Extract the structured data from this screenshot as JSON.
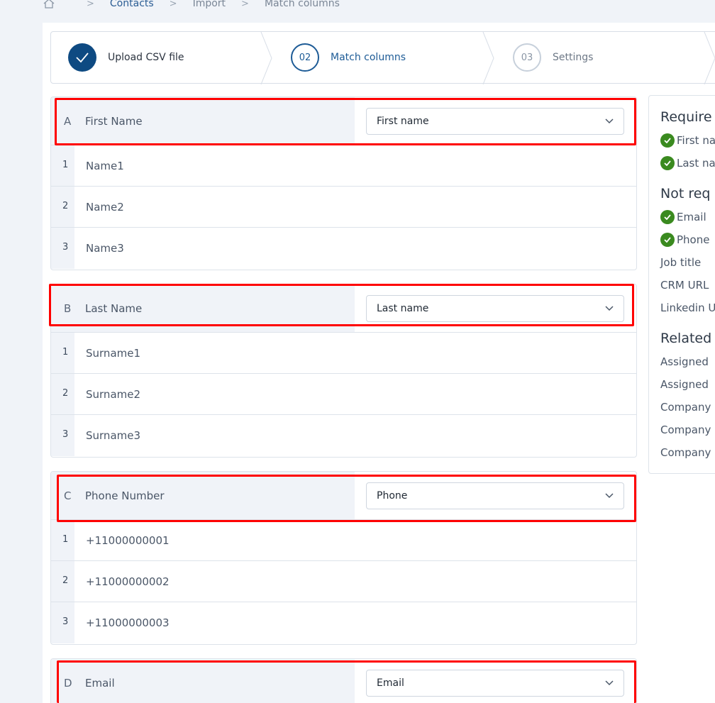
{
  "breadcrumb": {
    "items": [
      "Contacts",
      "Import",
      "Match columns"
    ]
  },
  "stepper": {
    "steps": [
      {
        "number": "",
        "label": "Upload CSV file"
      },
      {
        "number": "02",
        "label": "Match columns"
      },
      {
        "number": "03",
        "label": "Settings"
      }
    ]
  },
  "mappings": [
    {
      "letter": "A",
      "column": "First Name",
      "selected": "First name",
      "rows": [
        {
          "i": "1",
          "v": "Name1"
        },
        {
          "i": "2",
          "v": "Name2"
        },
        {
          "i": "3",
          "v": "Name3"
        }
      ]
    },
    {
      "letter": "B",
      "column": "Last Name",
      "selected": "Last name",
      "rows": [
        {
          "i": "1",
          "v": "Surname1"
        },
        {
          "i": "2",
          "v": "Surname2"
        },
        {
          "i": "3",
          "v": "Surname3"
        }
      ]
    },
    {
      "letter": "C",
      "column": "Phone Number",
      "selected": "Phone",
      "rows": [
        {
          "i": "1",
          "v": "+11000000001"
        },
        {
          "i": "2",
          "v": "+11000000002"
        },
        {
          "i": "3",
          "v": "+11000000003"
        }
      ]
    },
    {
      "letter": "D",
      "column": "Email",
      "selected": "Email",
      "rows": []
    }
  ],
  "sidebar": {
    "required_title": "Require",
    "required_items": [
      "First na",
      "Last na"
    ],
    "not_required_title": "Not req",
    "not_required_checked": [
      "Email",
      "Phone"
    ],
    "not_required_items": [
      "Job title",
      "CRM URL",
      "Linkedin U"
    ],
    "related_title": "Related",
    "related_items": [
      "Assigned",
      "Assigned",
      "Company",
      "Company",
      "Company"
    ]
  },
  "colors": {
    "accent": "#1d5b96",
    "check_green": "#3a8a1f",
    "highlight_red": "#ff0000"
  }
}
